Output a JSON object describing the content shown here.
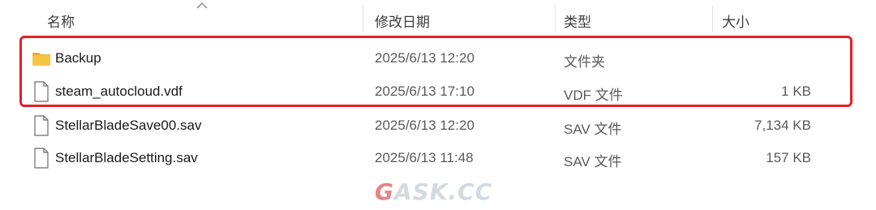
{
  "columns": {
    "name": "名称",
    "date_modified": "修改日期",
    "type": "类型",
    "size": "大小"
  },
  "files": [
    {
      "name": "Backup",
      "date": "2025/6/13 12:20",
      "type": "文件夹",
      "size": "",
      "icon": "folder-icon"
    },
    {
      "name": "steam_autocloud.vdf",
      "date": "2025/6/13 17:10",
      "type": "VDF 文件",
      "size": "1 KB",
      "icon": "file-icon"
    },
    {
      "name": "StellarBladeSave00.sav",
      "date": "2025/6/13 12:20",
      "type": "SAV 文件",
      "size": "7,134 KB",
      "icon": "file-icon"
    },
    {
      "name": "StellarBladeSetting.sav",
      "date": "2025/6/13 11:48",
      "type": "SAV 文件",
      "size": "157 KB",
      "icon": "file-icon"
    }
  ],
  "watermark": {
    "part1": "G",
    "part2": "ASK.CC"
  },
  "colors": {
    "highlight_border": "#e0202a",
    "folder": "#f6c445"
  }
}
